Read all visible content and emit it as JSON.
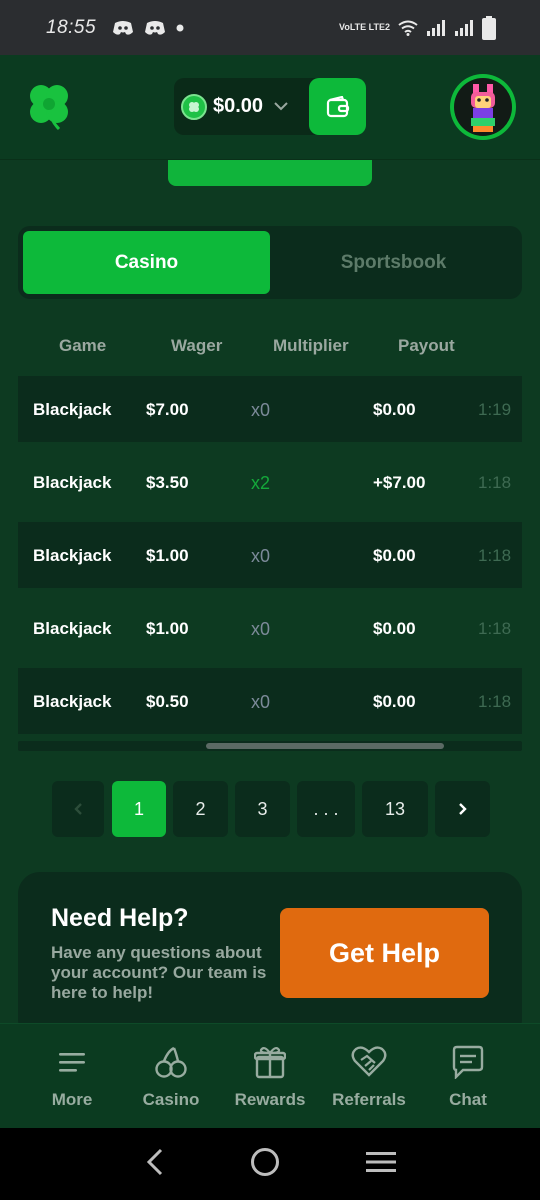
{
  "status_bar": {
    "time": "18:55",
    "network": "VoLTE LTE2"
  },
  "header": {
    "balance": "$0.00"
  },
  "tabs": [
    {
      "label": "Casino",
      "active": true
    },
    {
      "label": "Sportsbook",
      "active": false
    }
  ],
  "table": {
    "columns": [
      "Game",
      "Wager",
      "Multiplier",
      "Payout"
    ],
    "rows": [
      {
        "game": "Blackjack",
        "wager": "$7.00",
        "multiplier": "x0",
        "payout": "$0.00",
        "time": "1:19"
      },
      {
        "game": "Blackjack",
        "wager": "$3.50",
        "multiplier": "x2",
        "payout": "+$7.00",
        "time": "1:18"
      },
      {
        "game": "Blackjack",
        "wager": "$1.00",
        "multiplier": "x0",
        "payout": "$0.00",
        "time": "1:18"
      },
      {
        "game": "Blackjack",
        "wager": "$1.00",
        "multiplier": "x0",
        "payout": "$0.00",
        "time": "1:18"
      },
      {
        "game": "Blackjack",
        "wager": "$0.50",
        "multiplier": "x0",
        "payout": "$0.00",
        "time": "1:18"
      }
    ]
  },
  "pagination": {
    "pages": [
      "1",
      "2",
      "3",
      ". . .",
      "13"
    ],
    "current": "1"
  },
  "help": {
    "title": "Need Help?",
    "text": "Have any questions about your account? Our team is here to help!",
    "button": "Get Help"
  },
  "bottom_nav": [
    {
      "label": "More",
      "icon": "menu-icon"
    },
    {
      "label": "Casino",
      "icon": "cherries-icon"
    },
    {
      "label": "Rewards",
      "icon": "gift-icon"
    },
    {
      "label": "Referrals",
      "icon": "handshake-heart-icon"
    },
    {
      "label": "Chat",
      "icon": "chat-icon"
    }
  ],
  "colors": {
    "background": "#0d3a21",
    "accent": "#0db93a",
    "help_button": "#e06a0f",
    "win_multiplier": "#14a83a"
  }
}
